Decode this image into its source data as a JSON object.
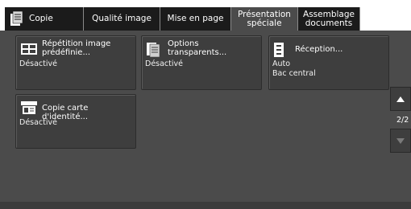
{
  "tabs": [
    {
      "label": "Copie",
      "active": false
    },
    {
      "label": "Qualité image",
      "active": false
    },
    {
      "label": "Mise en page",
      "active": false
    },
    {
      "label": "Présentation\nspéciale",
      "active": true
    },
    {
      "label": "Assemblage\ndocuments",
      "active": false
    }
  ],
  "tiles": [
    {
      "title": "Répétition image\nprédéfinie...",
      "value": "Désactivé",
      "icon": "repeat-image-icon"
    },
    {
      "title": "Options\ntransparents...",
      "value": "Désactivé",
      "icon": "transparency-options-icon"
    },
    {
      "title": "Réception...",
      "value": "Auto\nBac central",
      "icon": "output-tray-icon"
    },
    {
      "title": "Copie carte d'identité...",
      "value": "Désactivé",
      "icon": "id-card-copy-icon"
    }
  ],
  "scroll": {
    "page_indicator": "2/2"
  },
  "colors": {
    "background": "#4b4b4b",
    "tile": "#3e3e3e",
    "tab": "#1b1b1b",
    "tabbar_bg": "#ffffff"
  }
}
